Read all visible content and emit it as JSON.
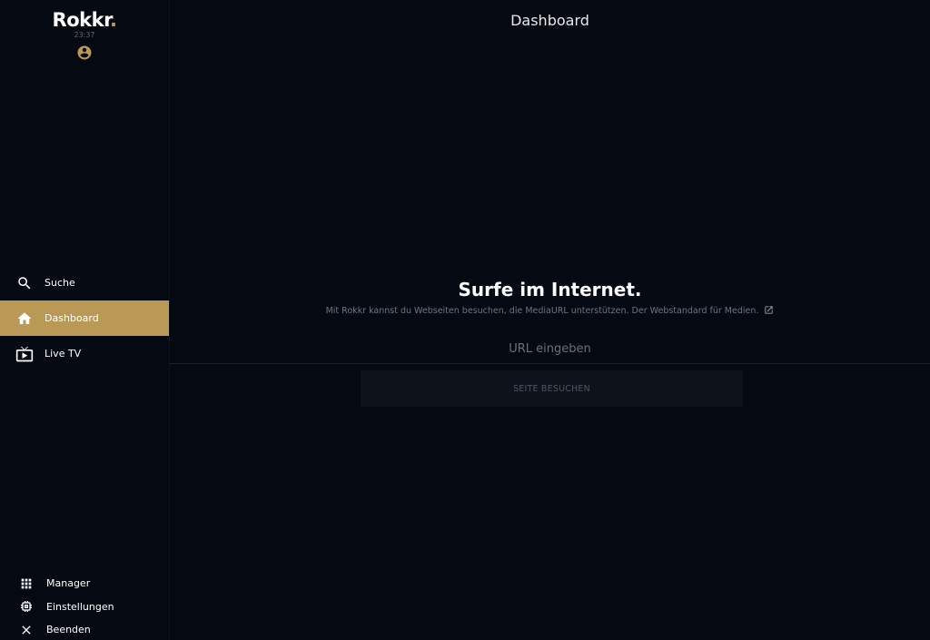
{
  "sidebar": {
    "logo": "Rokkr",
    "logo_dot": ".",
    "clock": "23:37",
    "profile_icon": "account-circle-icon",
    "accent_color": "#b99955",
    "nav": [
      {
        "label": "Suche",
        "icon": "search-icon",
        "active": false
      },
      {
        "label": "Dashboard",
        "icon": "home-icon",
        "active": true
      },
      {
        "label": "Live TV",
        "icon": "live-tv-icon",
        "active": false
      }
    ],
    "bottom": [
      {
        "label": "Manager",
        "icon": "grid-icon"
      },
      {
        "label": "Einstellungen",
        "icon": "settings-chip-icon"
      },
      {
        "label": "Beenden",
        "icon": "close-icon"
      }
    ]
  },
  "main": {
    "title": "Dashboard",
    "hero_title": "Surfe im Internet.",
    "hero_subtitle": "Mit Rokkr kannst du Webseiten besuchen, die MediaURL unterstützen. Der Webstandard für Medien.",
    "hero_link_icon": "open-in-new-icon",
    "url_input": {
      "placeholder": "URL eingeben",
      "value": ""
    },
    "visit_button": "SEITE BESUCHEN"
  },
  "colors": {
    "background": "#050a12",
    "accent": "#b99955",
    "button_bg": "#0e131b"
  }
}
